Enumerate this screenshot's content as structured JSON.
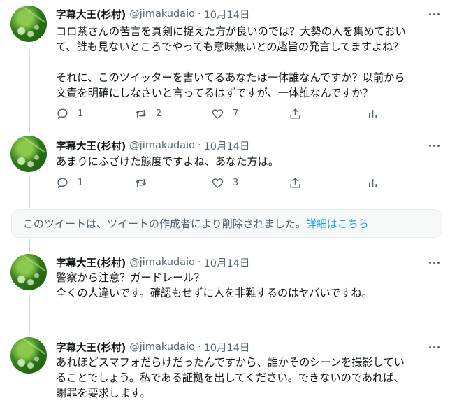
{
  "author": {
    "name": "字幕大王(杉村)",
    "handle": "@jimakudaio",
    "separator": "·",
    "date": "10月14日"
  },
  "tweets": [
    {
      "lines": [
        "コロ茶さんの苦言を真剣に捉えた方が良いのでは？大勢の人を集めておい",
        "て、誰も見ないところでやっても意味無いとの趣旨の発言してますよね？",
        "",
        "それに、このツイッターを書いてるあなたは一体誰なんですか？以前から",
        "文責を明確にしなさいと言ってるはずですが、一体誰なんですか？"
      ],
      "replies": "1",
      "retweets": "2",
      "likes": "7"
    },
    {
      "lines": [
        "あまりにふざけた態度ですよね、あなた方は。"
      ],
      "replies": "1",
      "retweets": "",
      "likes": "3"
    },
    {
      "lines": [
        "警察から注意？ガードレール？",
        "全くの人違いです。確認もせずに人を非難するのはヤバいですね。"
      ],
      "replies": "",
      "retweets": "",
      "likes": ""
    },
    {
      "lines": [
        "あれほどスマフォだらけだったんですから、誰かそのシーンを撮影してい",
        "ることでしょう。私である証拠を出してください。できないのであれば、",
        "謝罪を要求します。"
      ]
    }
  ],
  "deleted_notice": {
    "text": "このツイートは、ツイートの作成者により削除されました。",
    "link": "詳細はこちら"
  },
  "icons": {
    "reply": "reply-icon",
    "retweet": "retweet-icon",
    "like": "heart-icon",
    "share": "share-icon",
    "analytics": "analytics-icon",
    "more": "more-icon"
  },
  "colors": {
    "text": "#0f1419",
    "secondary": "#536471",
    "link": "#1d9bf0",
    "thread_line": "#cfd9de"
  }
}
